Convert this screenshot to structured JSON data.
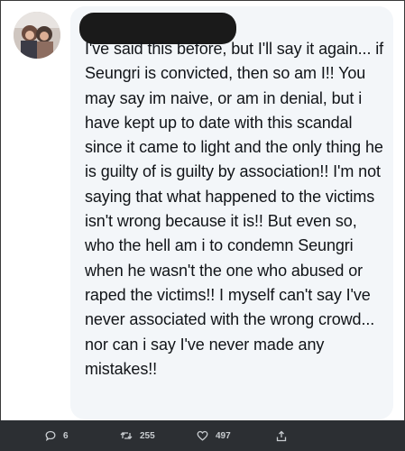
{
  "tweet": {
    "avatar_icon": "profile-photo",
    "author_redacted": true,
    "text": "I've said this before, but I'll say it again... if Seungri is convicted, then so am I!! You may say im naive, or am in denial, but i have kept up to date with this scandal since it came to light and the only thing he is guilty of is guilty by association!! I'm not saying that what happened to the victims isn't wrong because it is!! But even so, who the hell am i to condemn Seungri when he wasn't the one who abused or raped the victims!! I myself can't say I've never associated with the wrong crowd... nor can i say I've never made any mistakes!!"
  },
  "actions": {
    "reply_count": "6",
    "retweet_count": "255",
    "like_count": "497",
    "icons": [
      "reply-icon",
      "retweet-icon",
      "like-icon",
      "share-icon"
    ]
  },
  "colors": {
    "bubble": "#f3f6f9",
    "text": "#111418",
    "action_bar": "#2c2f33",
    "action_text": "#c8ccd0"
  }
}
